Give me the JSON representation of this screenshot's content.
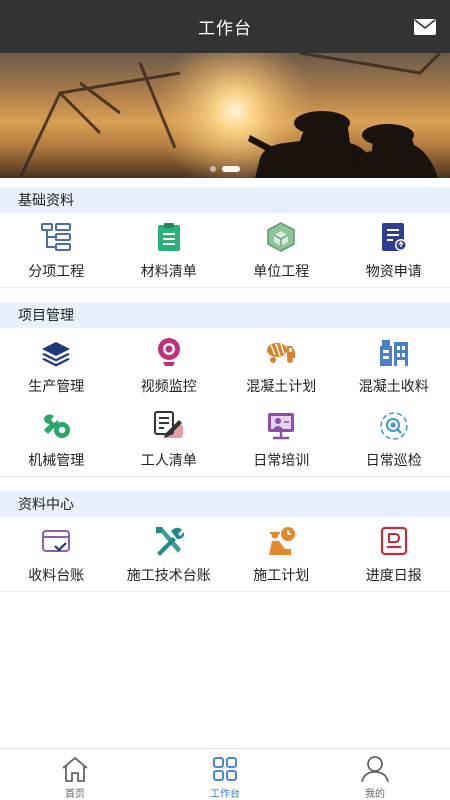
{
  "header": {
    "title": "工作台",
    "mail_icon": "mail-icon"
  },
  "banner": {
    "slides": 2,
    "active_slide": 2
  },
  "sections": [
    {
      "title": "基础资料",
      "items": [
        {
          "label": "分项工程",
          "icon": "tree-structure-icon",
          "color": "#4a6fa5"
        },
        {
          "label": "材料清单",
          "icon": "clipboard-list-icon",
          "color": "#2bb07a"
        },
        {
          "label": "单位工程",
          "icon": "cube-icon",
          "color": "#6aaa7a"
        },
        {
          "label": "物资申请",
          "icon": "document-upload-icon",
          "color": "#2f3e8f"
        }
      ]
    },
    {
      "title": "项目管理",
      "items": [
        {
          "label": "生产管理",
          "icon": "layers-icon",
          "color": "#1f3a7a"
        },
        {
          "label": "视频监控",
          "icon": "webcam-icon",
          "color": "#c0307a"
        },
        {
          "label": "混凝土计划",
          "icon": "mixer-truck-icon",
          "color": "#d9822b"
        },
        {
          "label": "混凝土收料",
          "icon": "plant-icon",
          "color": "#4a7fc9"
        },
        {
          "label": "机械管理",
          "icon": "wrench-gear-icon",
          "color": "#2aa86a"
        },
        {
          "label": "工人清单",
          "icon": "note-pen-icon",
          "color": "#333333"
        },
        {
          "label": "日常培训",
          "icon": "training-board-icon",
          "color": "#8a4fa8"
        },
        {
          "label": "日常巡检",
          "icon": "inspection-icon",
          "color": "#3f9ac9"
        }
      ]
    },
    {
      "title": "资料中心",
      "items": [
        {
          "label": "收料台账",
          "icon": "receipt-icon",
          "color": "#8a5fb0"
        },
        {
          "label": "施工技术台账",
          "icon": "tools-icon",
          "color": "#1f8a8a"
        },
        {
          "label": "施工计划",
          "icon": "worker-plan-icon",
          "color": "#e08a2b"
        },
        {
          "label": "进度日报",
          "icon": "daily-report-icon",
          "color": "#c0303a"
        }
      ]
    }
  ],
  "tabbar": [
    {
      "label": "首页",
      "icon": "home-icon",
      "active": false
    },
    {
      "label": "工作台",
      "icon": "grid-icon",
      "active": true
    },
    {
      "label": "我的",
      "icon": "user-icon",
      "active": false
    }
  ],
  "colors": {
    "header_bg": "#333333",
    "section_bg": "#e8f1fb",
    "active_tab": "#3a78c9"
  }
}
